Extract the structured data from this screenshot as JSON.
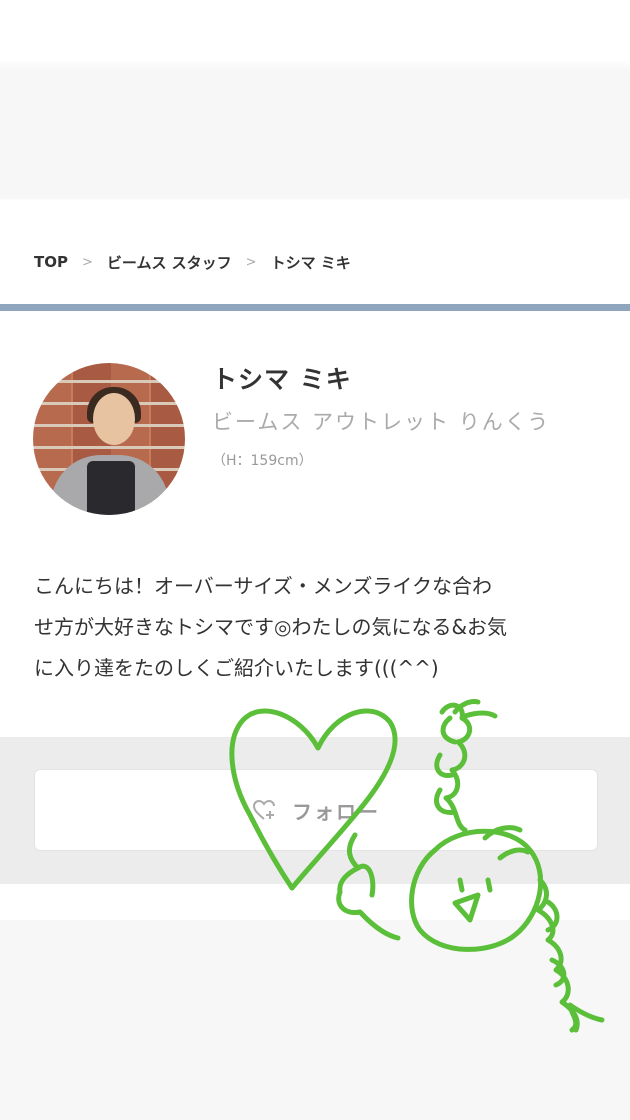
{
  "breadcrumb": {
    "items": [
      "TOP",
      "ビームス スタッフ",
      "トシマ ミキ"
    ],
    "separator": ">"
  },
  "profile": {
    "name": "トシマ ミキ",
    "store": "ビームス アウトレット りんくう",
    "height": "（H：159cm）"
  },
  "intro": {
    "line1": "こんにちは！オーバーサイズ・メンズライクな合わ",
    "line2": "せ方が大好きなトシマです◎わたしの気になる&お気",
    "line3": "に入り達をたのしくご紹介いたします(((^^)"
  },
  "follow": {
    "label": "フォロー",
    "icon": "heart-plus-icon"
  },
  "colors": {
    "divider": "#8fa4bd",
    "doodle": "#5bbf3a"
  }
}
